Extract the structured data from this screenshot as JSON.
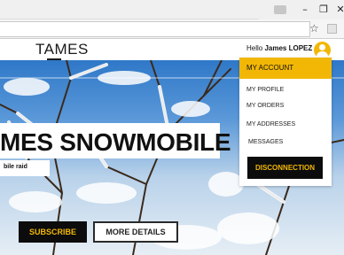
{
  "browser": {
    "window_controls": {
      "minimize": "–",
      "maximize": "❐",
      "close": "✕"
    },
    "bookmark_icon": "☆",
    "icons": [
      "profile-icon",
      "star-icon",
      "extension-icon"
    ]
  },
  "site": {
    "logo": "TAMES",
    "greeting": "Hello",
    "user_name": "James LOPEZ",
    "avatar_icon": "user-icon"
  },
  "hero": {
    "title": "MES SNOWMOBILE",
    "subtitle": "bile raid",
    "subscribe_label": "SUBSCRIBE",
    "more_details_label": "MORE DETAILS"
  },
  "account_menu": {
    "header": "MY ACCOUNT",
    "items": [
      "MY PROFILE",
      "MY ORDERS",
      "MY ADDRESSES",
      "MESSAGES"
    ],
    "logout_label": "DISCONNECTION"
  },
  "colors": {
    "accent": "#f2b705",
    "dark": "#0c0c0c",
    "sky": "#2f78c8"
  }
}
